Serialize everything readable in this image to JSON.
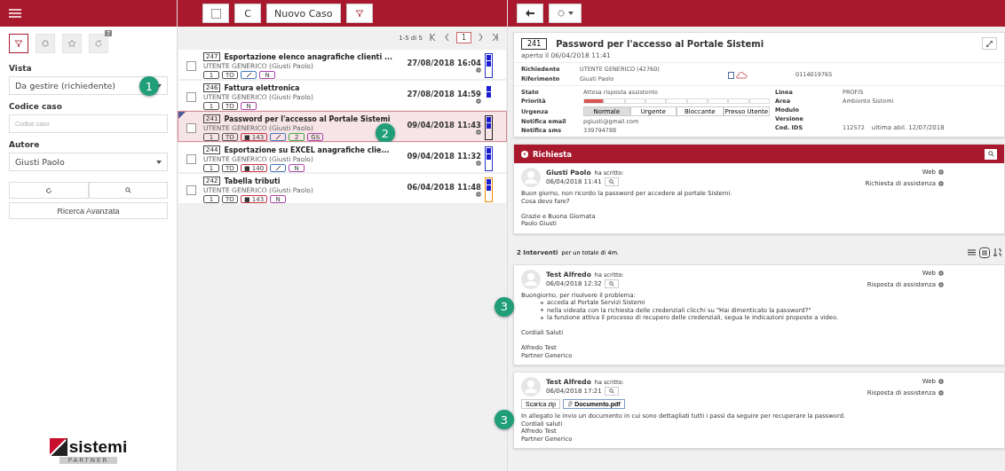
{
  "sidebar": {
    "tools": [
      {
        "kind": "filter",
        "selected": true
      },
      {
        "kind": "gear",
        "selected": false
      },
      {
        "kind": "star",
        "selected": false
      },
      {
        "kind": "history",
        "selected": false,
        "badge": "7"
      }
    ],
    "fields": [
      {
        "label": "Vista",
        "kind": "select",
        "value": "Da gestire (richiedente)",
        "callout": "1"
      },
      {
        "label": "Codice caso",
        "kind": "input",
        "placeholder": "Codice caso"
      },
      {
        "label": "Autore",
        "kind": "select",
        "value": "Giusti Paolo"
      }
    ],
    "advanced_search": "Ricerca Avanzata",
    "logo": {
      "name": "sistemi",
      "tagline": "PARTNER"
    }
  },
  "toolbar": {
    "new_case": "Nuovo Caso",
    "refresh": "C"
  },
  "pagination": {
    "range": "1-5 di 5",
    "page": "1"
  },
  "cases": [
    {
      "id": "247",
      "title": "Esportazione elenco anagrafiche clienti ...",
      "requester": "UTENTE GENERICO (Giusti Paolo)",
      "date": "27/08/2018 16:04",
      "selected": false,
      "color": "#2233cc",
      "tags": [
        {
          "kind": "text",
          "text": "1",
          "color": "#555555"
        },
        {
          "kind": "text",
          "text": "TO",
          "color": "#555555"
        },
        {
          "kind": "icon",
          "color": "#4477bb"
        },
        {
          "kind": "text",
          "text": "N",
          "color": "#aa44aa"
        }
      ]
    },
    {
      "id": "246",
      "title": "Fattura elettronica",
      "requester": "UTENTE GENERICO (Giusti Paolo)",
      "date": "27/08/2018 14:59",
      "selected": false,
      "color": "#ffffff",
      "tags": [
        {
          "kind": "text",
          "text": "1",
          "color": "#555555"
        },
        {
          "kind": "text",
          "text": "TO",
          "color": "#555555"
        },
        {
          "kind": "text",
          "text": "N",
          "color": "#aa44aa"
        }
      ]
    },
    {
      "id": "241",
      "title": "Password per l'accesso al Portale Sistemi",
      "requester": "UTENTE GENERICO (Giusti Paolo)",
      "date": "09/04/2018 11:43",
      "selected": true,
      "color": "#222222",
      "callout": "2",
      "tags": [
        {
          "kind": "text",
          "text": "1",
          "color": "#555555"
        },
        {
          "kind": "text",
          "text": "TO",
          "color": "#555555"
        },
        {
          "kind": "text",
          "text": "■ 143",
          "color": "#cc3344"
        },
        {
          "kind": "icon",
          "color": "#4477bb"
        },
        {
          "kind": "text",
          "text": "2",
          "color": "#44aa44"
        },
        {
          "kind": "text",
          "text": "GS",
          "color": "#aa44aa"
        }
      ]
    },
    {
      "id": "244",
      "title": "Esportazione su EXCEL anagrafiche clie...",
      "requester": "UTENTE GENERICO (Giusti Paolo)",
      "date": "09/04/2018 11:32",
      "selected": false,
      "color": "#2233cc",
      "tags": [
        {
          "kind": "text",
          "text": "1",
          "color": "#555555"
        },
        {
          "kind": "text",
          "text": "TO",
          "color": "#555555"
        },
        {
          "kind": "text",
          "text": "■ 140",
          "color": "#cc3344"
        },
        {
          "kind": "icon",
          "color": "#4477bb"
        },
        {
          "kind": "text",
          "text": "N",
          "color": "#aa44aa"
        }
      ]
    },
    {
      "id": "242",
      "title": "Tabella tributi",
      "requester": "UTENTE GENERICO (Giusti Paolo)",
      "date": "06/04/2018 11:48",
      "selected": false,
      "color": "#ee8800",
      "tags": [
        {
          "kind": "text",
          "text": "1",
          "color": "#555555"
        },
        {
          "kind": "text",
          "text": "TO",
          "color": "#555555"
        },
        {
          "kind": "text",
          "text": "■ 143",
          "color": "#cc3344"
        },
        {
          "kind": "text",
          "text": "N",
          "color": "#aa44aa"
        }
      ]
    }
  ],
  "detail": {
    "id": "241",
    "title": "Password per l'accesso al Portale Sistemi",
    "opened": "aperto il 06/04/2018 11:41",
    "contact": [
      {
        "label": "Richiedente",
        "value": "UTENTE GENERICO (42760)"
      },
      {
        "label": "Riferimento",
        "value": "Giusti Paolo"
      }
    ],
    "phone": "0114019765",
    "left": [
      {
        "label": "Stato",
        "kind": "text",
        "value": "Attesa risposta assistente"
      },
      {
        "label": "Priorità",
        "kind": "priority",
        "level": 0.11
      },
      {
        "label": "Urgenza",
        "kind": "urgency",
        "options": [
          {
            "label": "Normale",
            "selected": true
          },
          {
            "label": "Urgente",
            "selected": false
          },
          {
            "label": "Bloccante",
            "selected": false
          },
          {
            "label": "Presso Utente",
            "selected": false
          }
        ]
      },
      {
        "label": "Notifica email",
        "kind": "text",
        "value": "pgiusti@gmail.com"
      },
      {
        "label": "Notifica sms",
        "kind": "text",
        "value": "339794788"
      }
    ],
    "right": [
      {
        "label": "Linea",
        "value": "PROFIS"
      },
      {
        "label": "Area",
        "value": "Ambiente Sistemi"
      },
      {
        "label": "Modulo"
      },
      {
        "label": "Versione"
      },
      {
        "label": "Cod. IDS",
        "value": "112572",
        "note": "ultima abil. 12/07/2018"
      }
    ]
  },
  "request": {
    "title": "Richiesta",
    "message": {
      "author": "Giusti Paolo",
      "wrote": "ha scritto:",
      "date": "06/04/2018 11:41",
      "channel": "Web",
      "type": "Richiesta di assistenza",
      "body": [
        [
          "Buon giorno, non ricordo la password per accedere al portale Sistemi.",
          "Cosa devo fare?"
        ],
        [
          "Grazie e Buona Giornata",
          "Paolo Giusti"
        ]
      ]
    }
  },
  "interventions": {
    "count": "2 Interventi",
    "total": "per un totale di 4m.",
    "items": [
      {
        "author": "Test Alfredo",
        "wrote": "ha scritto:",
        "date": "06/04/2018 12:32",
        "channel": "Web",
        "type": "Risposta di assistenza",
        "callout": "3",
        "body": [
          [
            "Buongiorno, per risolvere il problema:"
          ]
        ],
        "bullets": [
          "acceda al Portale Servizi Sistemi",
          "nella videata con la richiesta delle credenziali clicchi su \"Hai dimenticato la password?\"",
          "la funzione attiva il processo di recupero delle credenziali, segua le indicazioni proposte a video."
        ],
        "closing": [
          [
            "Cordiali Saluti"
          ],
          [
            "Alfredo Test",
            "Partner Generico"
          ]
        ]
      },
      {
        "author": "Test Alfredo",
        "wrote": "ha scritto:",
        "date": "06/04/2018 17:21",
        "channel": "Web",
        "type": "Risposta di assistenza",
        "callout": "3",
        "zip": "Scarica zip",
        "attachment": "Documento.pdf",
        "body": [
          [
            "In allegato le invio un documento in cui sono dettagliati tutti i passi da seguire per recuperare la password.",
            "Cordiali saluti",
            "Alfredo Test",
            "Partner Generico"
          ]
        ]
      }
    ]
  }
}
